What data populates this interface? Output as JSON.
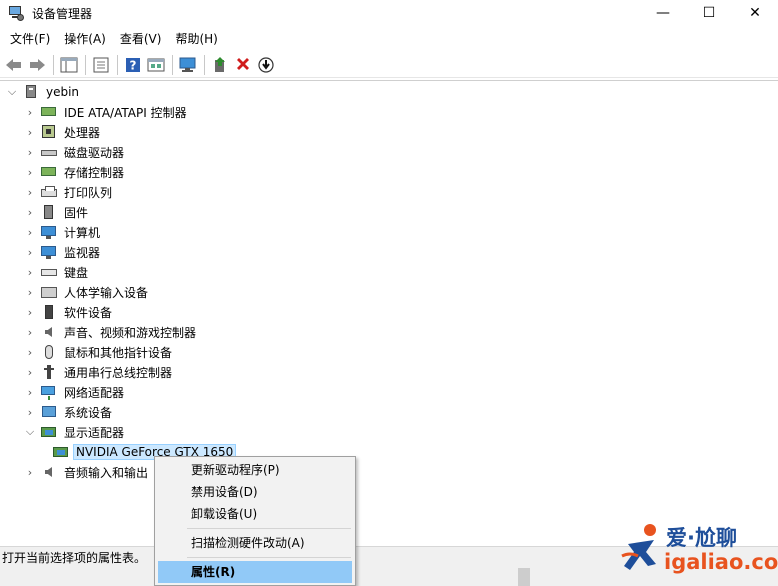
{
  "window": {
    "title": "设备管理器",
    "minimize": "—",
    "maximize": "☐",
    "close": "✕"
  },
  "menubar": {
    "items": [
      "文件(F)",
      "操作(A)",
      "查看(V)",
      "帮助(H)"
    ]
  },
  "toolbar": {
    "buttons": [
      "back-icon",
      "forward-icon",
      "show-hide-tree-icon",
      "properties-icon",
      "help-icon",
      "view-icon",
      "scan-hardware-icon",
      "update-driver-icon",
      "uninstall-icon",
      "disable-icon"
    ],
    "colors": {
      "red_x": "#d01c1c",
      "green": "#2e8b2e"
    }
  },
  "tree": {
    "root": "yebin",
    "categories": [
      "IDE ATA/ATAPI 控制器",
      "处理器",
      "磁盘驱动器",
      "存储控制器",
      "打印队列",
      "固件",
      "计算机",
      "监视器",
      "键盘",
      "人体学输入设备",
      "软件设备",
      "声音、视频和游戏控制器",
      "鼠标和其他指针设备",
      "通用串行总线控制器",
      "网络适配器",
      "系统设备",
      "显示适配器"
    ],
    "expanded_child": "NVIDIA GeForce GTX 1650",
    "after": "音频输入和输出"
  },
  "context_menu": {
    "items": [
      "更新驱动程序(P)",
      "禁用设备(D)",
      "卸载设备(U)"
    ],
    "scan": "扫描检测硬件改动(A)",
    "properties": "属性(R)",
    "highlight_color": "#91c9f7"
  },
  "statusbar": {
    "text": "打开当前选择项的属性表。"
  },
  "watermark": {
    "cn": "爱·尬聊",
    "url": "igaliao.com"
  }
}
